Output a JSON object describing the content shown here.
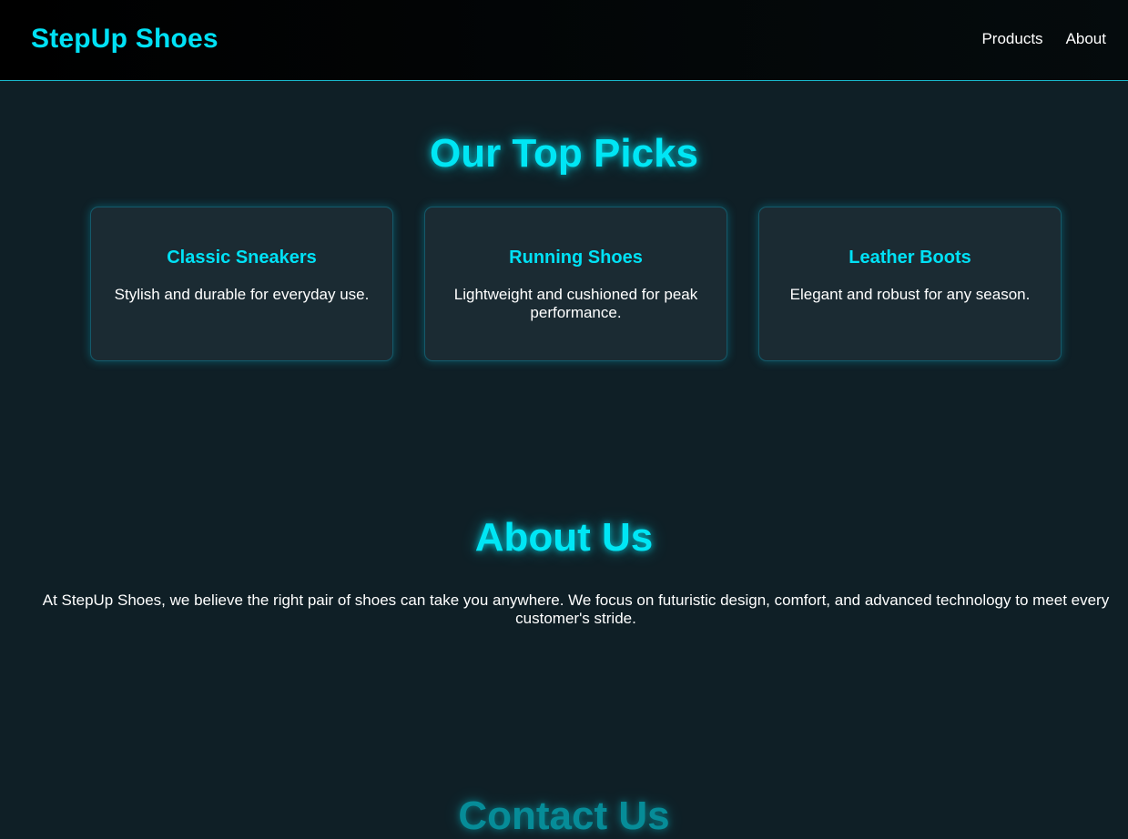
{
  "header": {
    "logo": "StepUp Shoes",
    "nav": [
      {
        "label": "Products"
      },
      {
        "label": "About"
      }
    ]
  },
  "top_picks": {
    "title": "Our Top Picks",
    "cards": [
      {
        "title": "Classic Sneakers",
        "description": "Stylish and durable for everyday use."
      },
      {
        "title": "Running Shoes",
        "description": "Lightweight and cushioned for peak performance."
      },
      {
        "title": "Leather Boots",
        "description": "Elegant and robust for any season."
      }
    ]
  },
  "about": {
    "title": "About Us",
    "text": "At StepUp Shoes, we believe the right pair of shoes can take you anywhere. We focus on futuristic design, comfort, and advanced technology to meet every customer's stride."
  },
  "contact": {
    "title": "Contact Us"
  },
  "colors": {
    "accent": "#00e1f5",
    "background": "#0f1f26",
    "card_background": "#1b2b33",
    "header_background": "#000000"
  }
}
